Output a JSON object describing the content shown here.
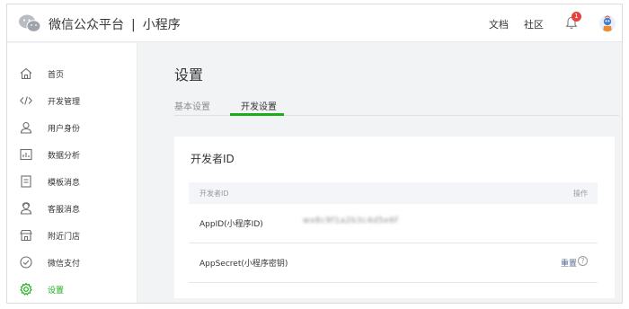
{
  "header": {
    "platform_name": "微信公众平台",
    "separator": "|",
    "product_name": "小程序",
    "nav": [
      {
        "label": "文档"
      },
      {
        "label": "社区"
      }
    ],
    "notification_count": "1",
    "logo_icon": "wechat-logo-icon",
    "avatar_icon": "avatar-icon"
  },
  "sidebar": {
    "items": [
      {
        "label": "首页",
        "icon": "home-icon",
        "active": false
      },
      {
        "label": "开发管理",
        "icon": "code-icon",
        "active": false
      },
      {
        "label": "用户身份",
        "icon": "user-icon",
        "active": false
      },
      {
        "label": "数据分析",
        "icon": "chart-icon",
        "active": false
      },
      {
        "label": "模板消息",
        "icon": "document-icon",
        "active": false
      },
      {
        "label": "客服消息",
        "icon": "headset-user-icon",
        "active": false
      },
      {
        "label": "附近门店",
        "icon": "store-icon",
        "active": false
      },
      {
        "label": "微信支付",
        "icon": "pay-icon",
        "active": false
      },
      {
        "label": "设置",
        "icon": "gear-icon",
        "active": true
      }
    ]
  },
  "main": {
    "title": "设置",
    "tabs": [
      {
        "label": "基本设置",
        "active": false
      },
      {
        "label": "开发设置",
        "active": true
      }
    ],
    "card": {
      "title": "开发者ID",
      "table": {
        "headers": [
          "开发者ID",
          "操作"
        ],
        "rows": [
          {
            "label": "AppID(小程序ID)",
            "value": "wx8c9f1a2b3c4d5e6f",
            "action": ""
          },
          {
            "label": "AppSecret(小程序密钥)",
            "value": "",
            "action": "重置"
          }
        ]
      }
    }
  },
  "colors": {
    "accent": "#1aad19",
    "link": "#576b95",
    "badge": "#e64340",
    "background": "#f2f3f5"
  }
}
